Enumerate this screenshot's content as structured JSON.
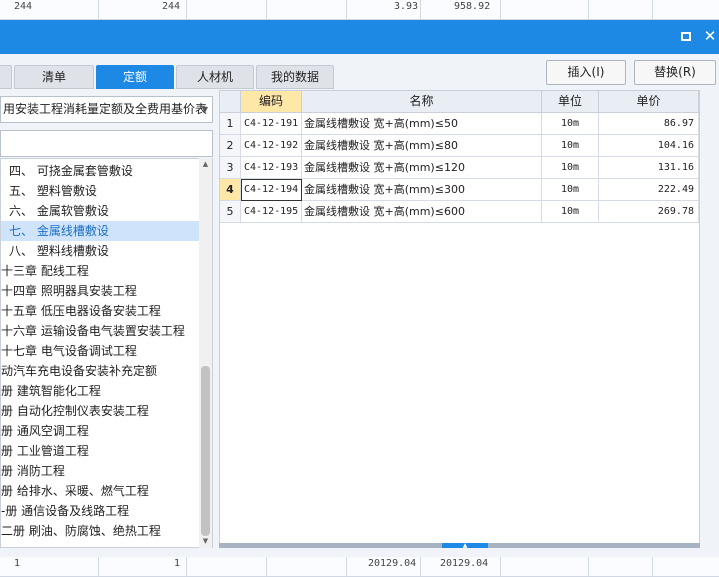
{
  "background_rows": {
    "top": [
      "244",
      "244",
      "3.93",
      "958.92"
    ],
    "bottom": [
      "1",
      "1",
      "20129.04",
      "20129.04"
    ]
  },
  "tabs": [
    {
      "label": "清单"
    },
    {
      "label": "定额"
    },
    {
      "label": "人材机"
    },
    {
      "label": "我的数据"
    }
  ],
  "actions": {
    "insert_label": "插入(I)",
    "replace_label": "替换(R)"
  },
  "quota_library": {
    "selected": "用安装工程消耗量定额及全费用基价表"
  },
  "tree": [
    {
      "label": "四、 可挠金属套管敷设"
    },
    {
      "label": "五、 塑料管敷设"
    },
    {
      "label": "六、 金属软管敷设"
    },
    {
      "label": "七、 金属线槽敷设"
    },
    {
      "label": "八、 塑料线槽敷设"
    },
    {
      "label": "十三章 配线工程"
    },
    {
      "label": "十四章 照明器具安装工程"
    },
    {
      "label": "十五章 低压电器设备安装工程"
    },
    {
      "label": "十六章 运输设备电气装置安装工程"
    },
    {
      "label": "十七章 电气设备调试工程"
    },
    {
      "label": "动汽车充电设备安装补充定额"
    },
    {
      "label": "册 建筑智能化工程"
    },
    {
      "label": "册 自动化控制仪表安装工程"
    },
    {
      "label": "册 通风空调工程"
    },
    {
      "label": "册 工业管道工程"
    },
    {
      "label": "册 消防工程"
    },
    {
      "label": "册 给排水、采暖、燃气工程"
    },
    {
      "label": "-册 通信设备及线路工程"
    },
    {
      "label": "二册 刷油、防腐蚀、绝热工程"
    }
  ],
  "grid": {
    "headers": {
      "code": "编码",
      "name": "名称",
      "unit": "单位",
      "price": "单价"
    },
    "rows": [
      {
        "idx": "1",
        "code": "C4-12-191",
        "name": "金属线槽敷设 宽+高(mm)≤50",
        "unit": "10m",
        "price": "86.97"
      },
      {
        "idx": "2",
        "code": "C4-12-192",
        "name": "金属线槽敷设 宽+高(mm)≤80",
        "unit": "10m",
        "price": "104.16"
      },
      {
        "idx": "3",
        "code": "C4-12-193",
        "name": "金属线槽敷设 宽+高(mm)≤120",
        "unit": "10m",
        "price": "131.16"
      },
      {
        "idx": "4",
        "code": "C4-12-194",
        "name": "金属线槽敷设 宽+高(mm)≤300",
        "unit": "10m",
        "price": "222.49"
      },
      {
        "idx": "5",
        "code": "C4-12-195",
        "name": "金属线槽敷设 宽+高(mm)≤600",
        "unit": "10m",
        "price": "269.78"
      }
    ]
  },
  "icons": {
    "maximize": "maximize-icon",
    "close": "close-icon",
    "dropdown": "chevron-down-icon",
    "scroll_up": "scroll-up-icon",
    "scroll_down": "scroll-down-icon",
    "splitter": "collapse-up-icon"
  },
  "colors": {
    "accent": "#1e88e5",
    "selected_row": "#cfe4fa",
    "code_header": "#ffe7a8"
  }
}
